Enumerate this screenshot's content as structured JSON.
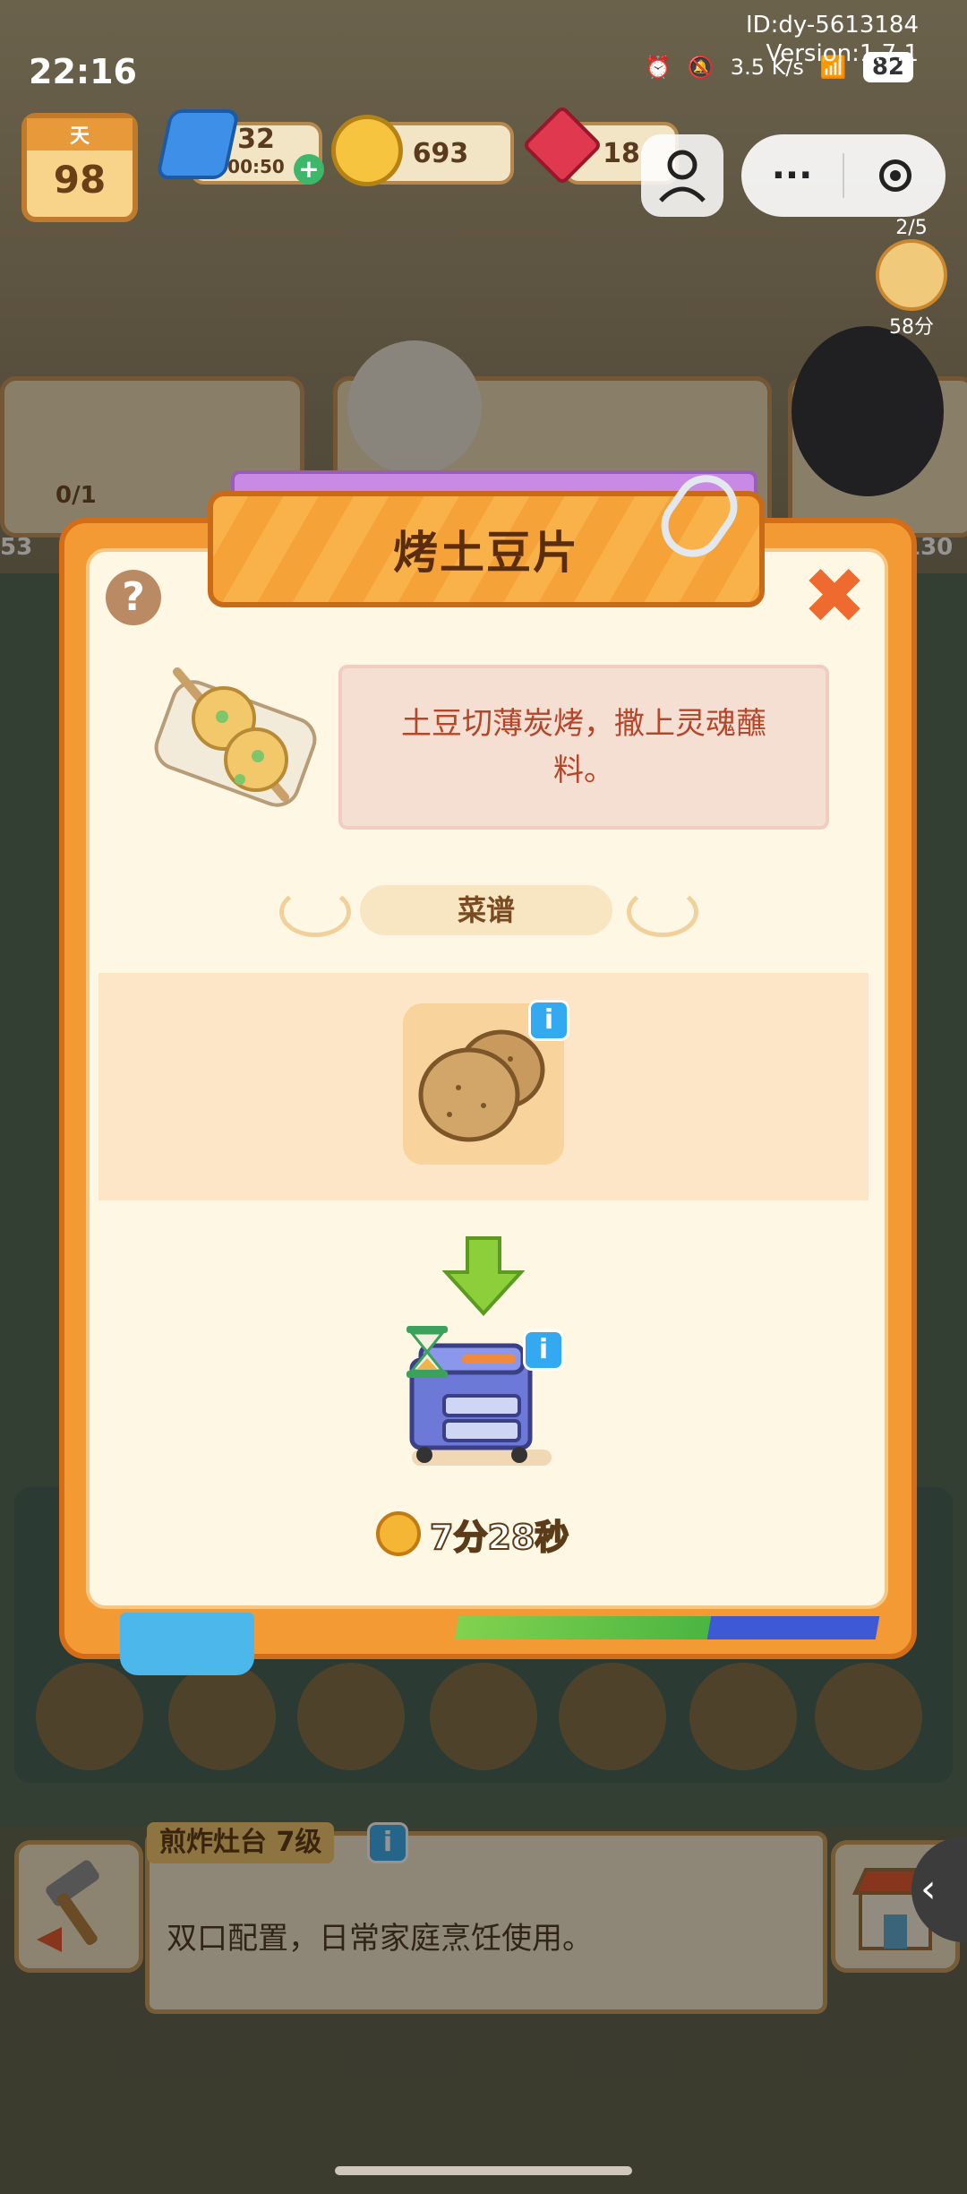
{
  "status_bar": {
    "time": "22:16",
    "network_speed": "3.5 K/s",
    "battery": "82",
    "app_id": "ID:dy-5613184",
    "app_version": "Version:1.7.1"
  },
  "hud": {
    "day_label": "天",
    "day_value": "98",
    "energy_value": "32",
    "energy_timer": "00:50",
    "coins": "693",
    "gems": "18"
  },
  "side_timer": {
    "count": "2/5",
    "time": "58分"
  },
  "background_cards": {
    "order_progress": "0/1",
    "left_edge_value": "53",
    "right_edge_value": "130"
  },
  "dialog": {
    "title": "烤土豆片",
    "description": "土豆切薄炭烤，撒上灵魂蘸料。",
    "recipe_tab": "菜谱",
    "ingredient_icon": "potato-icon",
    "station_icon": "grill-cooker-icon",
    "cook_time": "7分28秒",
    "help_symbol": "?",
    "close_symbol": "✖"
  },
  "bottom_panel": {
    "station_name": "煎炸灶台 7级",
    "station_desc": "双口配置，日常家庭烹饪使用。"
  },
  "colors": {
    "dialog_orange": "#f39a34",
    "title_text": "#5b2d0d",
    "desc_text": "#b5462a",
    "info_blue": "#32a9f0"
  }
}
